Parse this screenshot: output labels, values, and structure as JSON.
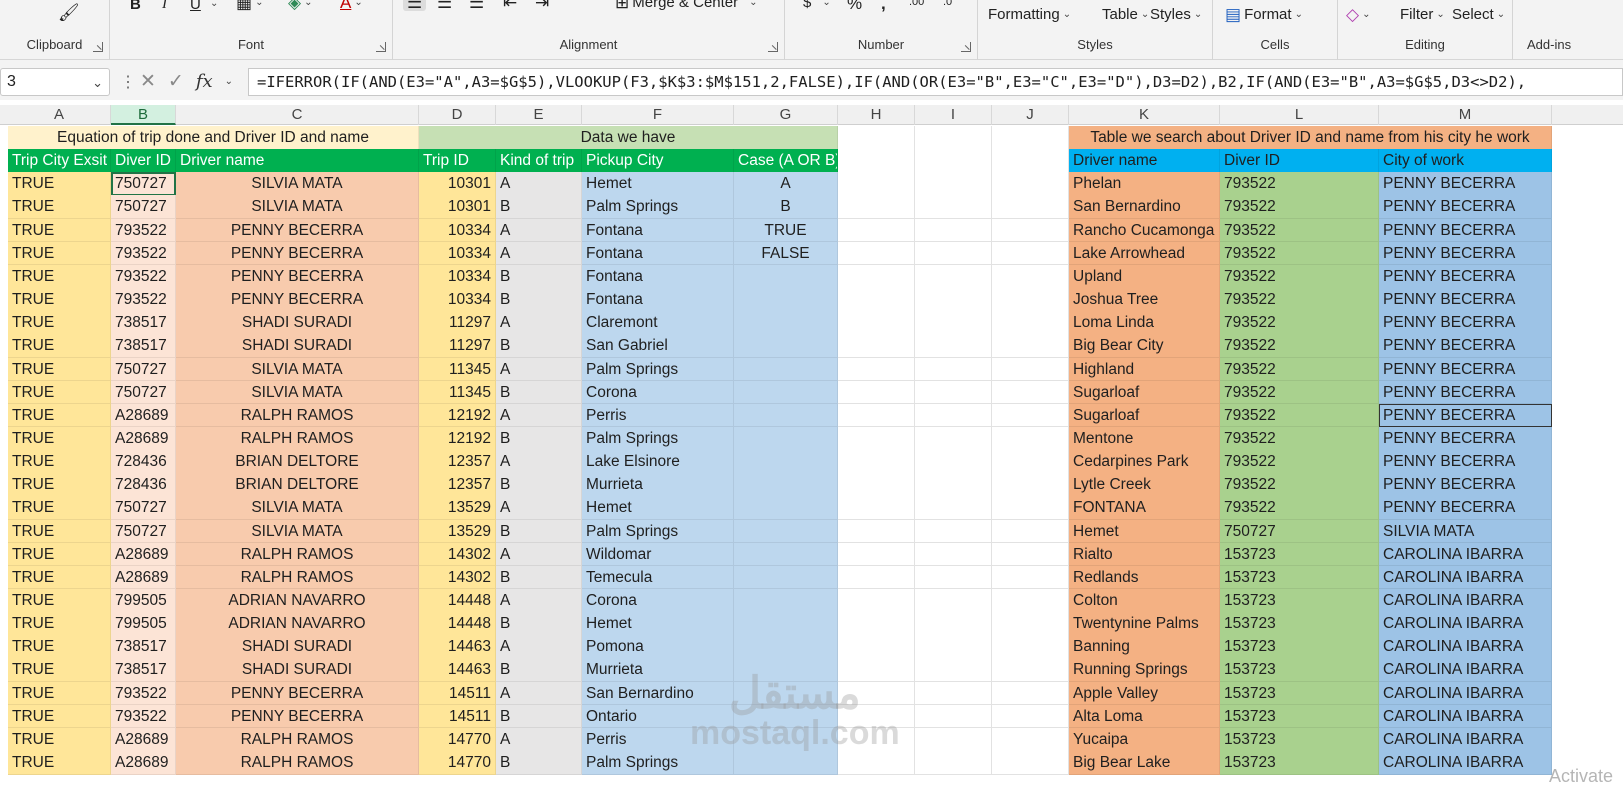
{
  "ribbon": {
    "clipboard_label": "Clipboard",
    "font_label": "Font",
    "alignment_label": "Alignment",
    "number_label": "Number",
    "styles_label": "Styles",
    "cells_label": "Cells",
    "editing_label": "Editing",
    "addins_label": "Add-ins",
    "merge_center": "Merge & Center",
    "formatting": "Formatting",
    "table": "Table",
    "styles_btn": "Styles",
    "format": "Format",
    "filter": "Filter",
    "select": "Select",
    "bold": "B",
    "italic": "I",
    "underline": "U",
    "dollar": "$",
    "percent": "%",
    "comma": ",",
    "dec_increase": ".00",
    "dec_decrease": ".0"
  },
  "formula_bar": {
    "name_box": "3",
    "fx": "fx",
    "formula": "=IFERROR(IF(AND(E3=\"A\",A3=$G$5),VLOOKUP(F3,$K$3:$M$151,2,FALSE),IF(AND(OR(E3=\"B\",E3=\"C\",E3=\"D\"),D3=D2),B2,IF(AND(E3=\"B\",A3=$G$5,D3<>D2),"
  },
  "columns": [
    "A",
    "B",
    "C",
    "D",
    "E",
    "F",
    "G",
    "H",
    "I",
    "J",
    "K",
    "L",
    "M"
  ],
  "group_headers": {
    "left": "Equation of trip done and Driver ID and name",
    "middle": "Data we have",
    "right": "Table we search about Driver ID and name from his city he work"
  },
  "field_headers": {
    "a": "Trip City Exsit",
    "b": "Diver ID",
    "c": "Driver name",
    "d": "Trip ID",
    "e": "Kind of trip",
    "f": "Pickup City",
    "g": "Case (A OR B)",
    "k": "Driver name",
    "l": "Diver ID",
    "m": "City of work"
  },
  "case_values": [
    "A",
    "B",
    "TRUE",
    "FALSE"
  ],
  "left_rows": [
    [
      "TRUE",
      "750727",
      "SILVIA MATA",
      "10301",
      "A",
      "Hemet"
    ],
    [
      "TRUE",
      "750727",
      "SILVIA MATA",
      "10301",
      "B",
      "Palm Springs"
    ],
    [
      "TRUE",
      "793522",
      "PENNY BECERRA",
      "10334",
      "A",
      "Fontana"
    ],
    [
      "TRUE",
      "793522",
      "PENNY BECERRA",
      "10334",
      "A",
      "Fontana"
    ],
    [
      "TRUE",
      "793522",
      "PENNY BECERRA",
      "10334",
      "B",
      "Fontana"
    ],
    [
      "TRUE",
      "793522",
      "PENNY BECERRA",
      "10334",
      "B",
      "Fontana"
    ],
    [
      "TRUE",
      "738517",
      "SHADI SURADI",
      "11297",
      "A",
      "Claremont"
    ],
    [
      "TRUE",
      "738517",
      "SHADI SURADI",
      "11297",
      "B",
      "San Gabriel"
    ],
    [
      "TRUE",
      "750727",
      "SILVIA MATA",
      "11345",
      "A",
      "Palm Springs"
    ],
    [
      "TRUE",
      "750727",
      "SILVIA MATA",
      "11345",
      "B",
      "Corona"
    ],
    [
      "TRUE",
      "A28689",
      "RALPH RAMOS",
      "12192",
      "A",
      "Perris"
    ],
    [
      "TRUE",
      "A28689",
      "RALPH RAMOS",
      "12192",
      "B",
      "Palm Springs"
    ],
    [
      "TRUE",
      "728436",
      "BRIAN DELTORE",
      "12357",
      "A",
      "Lake Elsinore"
    ],
    [
      "TRUE",
      "728436",
      "BRIAN DELTORE",
      "12357",
      "B",
      "Murrieta"
    ],
    [
      "TRUE",
      "750727",
      "SILVIA MATA",
      "13529",
      "A",
      "Hemet"
    ],
    [
      "TRUE",
      "750727",
      "SILVIA MATA",
      "13529",
      "B",
      "Palm Springs"
    ],
    [
      "TRUE",
      "A28689",
      "RALPH RAMOS",
      "14302",
      "A",
      "Wildomar"
    ],
    [
      "TRUE",
      "A28689",
      "RALPH RAMOS",
      "14302",
      "B",
      "Temecula"
    ],
    [
      "TRUE",
      "799505",
      "ADRIAN NAVARRO",
      "14448",
      "A",
      "Corona"
    ],
    [
      "TRUE",
      "799505",
      "ADRIAN NAVARRO",
      "14448",
      "B",
      "Hemet"
    ],
    [
      "TRUE",
      "738517",
      "SHADI SURADI",
      "14463",
      "A",
      "Pomona"
    ],
    [
      "TRUE",
      "738517",
      "SHADI SURADI",
      "14463",
      "B",
      "Murrieta"
    ],
    [
      "TRUE",
      "793522",
      "PENNY BECERRA",
      "14511",
      "A",
      "San Bernardino"
    ],
    [
      "TRUE",
      "793522",
      "PENNY BECERRA",
      "14511",
      "B",
      "Ontario"
    ],
    [
      "TRUE",
      "A28689",
      "RALPH RAMOS",
      "14770",
      "A",
      "Perris"
    ],
    [
      "TRUE",
      "A28689",
      "RALPH RAMOS",
      "14770",
      "B",
      "Palm Springs"
    ]
  ],
  "right_rows": [
    [
      "Phelan",
      "793522",
      "PENNY BECERRA"
    ],
    [
      "San Bernardino",
      "793522",
      "PENNY BECERRA"
    ],
    [
      "Rancho Cucamonga",
      "793522",
      "PENNY BECERRA"
    ],
    [
      "Lake Arrowhead",
      "793522",
      "PENNY BECERRA"
    ],
    [
      "Upland",
      "793522",
      "PENNY BECERRA"
    ],
    [
      "Joshua Tree",
      "793522",
      "PENNY BECERRA"
    ],
    [
      "Loma Linda",
      "793522",
      "PENNY BECERRA"
    ],
    [
      "Big Bear City",
      "793522",
      "PENNY BECERRA"
    ],
    [
      "Highland",
      "793522",
      "PENNY BECERRA"
    ],
    [
      "Sugarloaf",
      "793522",
      "PENNY BECERRA"
    ],
    [
      "Sugarloaf",
      "793522",
      "PENNY BECERRA"
    ],
    [
      "Mentone",
      "793522",
      "PENNY BECERRA"
    ],
    [
      "Cedarpines Park",
      "793522",
      "PENNY BECERRA"
    ],
    [
      "Lytle Creek",
      "793522",
      "PENNY BECERRA"
    ],
    [
      "FONTANA",
      "793522",
      "PENNY BECERRA"
    ],
    [
      "Hemet",
      "750727",
      "SILVIA MATA"
    ],
    [
      "Rialto",
      "153723",
      "CAROLINA IBARRA"
    ],
    [
      "Redlands",
      "153723",
      "CAROLINA IBARRA"
    ],
    [
      "Colton",
      "153723",
      "CAROLINA IBARRA"
    ],
    [
      "Twentynine Palms",
      "153723",
      "CAROLINA IBARRA"
    ],
    [
      "Banning",
      "153723",
      "CAROLINA IBARRA"
    ],
    [
      "Running Springs",
      "153723",
      "CAROLINA IBARRA"
    ],
    [
      "Apple Valley",
      "153723",
      "CAROLINA IBARRA"
    ],
    [
      "Alta Loma",
      "153723",
      "CAROLINA IBARRA"
    ],
    [
      "Yucaipa",
      "153723",
      "CAROLINA IBARRA"
    ],
    [
      "Big Bear Lake",
      "153723",
      "CAROLINA IBARRA"
    ]
  ],
  "watermark": {
    "arabic": "مستقل",
    "latin": "mostaql.com"
  },
  "activate_text": "Activate",
  "colors": {
    "col_a": "#ffe699",
    "col_b": "#fce4d6",
    "col_c": "#f8cbad",
    "col_d": "#ffe699",
    "col_e": "#e7e6e6",
    "col_f": "#bdd7ee",
    "col_g": "#bdd7ee",
    "col_k": "#f4b183",
    "col_l": "#a9d18e",
    "col_m": "#9dc3e6",
    "hdr_green": "#00b050",
    "hdr_blue": "#00b0f0",
    "group_left": "#fff2cc",
    "group_mid": "#c6e0b4",
    "group_right": "#f4b183"
  }
}
